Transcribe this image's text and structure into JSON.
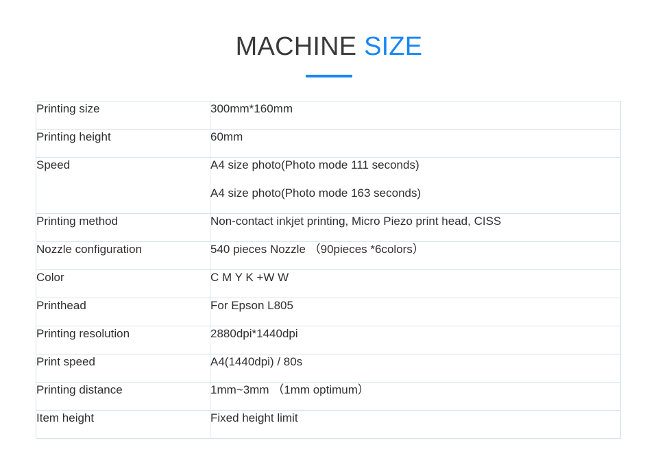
{
  "header": {
    "title_main": "MACHINE ",
    "title_accent": "SIZE",
    "accent_color": "#1687f5",
    "title_color": "#3a3a3a",
    "underline_color": "#1687f5"
  },
  "spec_table": {
    "border_color": "#d4e4f2",
    "rows": [
      {
        "label": "Printing size",
        "values": [
          "300mm*160mm"
        ]
      },
      {
        "label": "Printing height",
        "values": [
          "60mm"
        ]
      },
      {
        "label": "Speed",
        "values": [
          "A4 size photo(Photo mode 111 seconds)",
          "A4 size photo(Photo mode 163 seconds)"
        ]
      },
      {
        "label": "Printing method",
        "values": [
          "Non-contact inkjet printing, Micro Piezo print head, CISS"
        ]
      },
      {
        "label": "Nozzle configuration",
        "values": [
          "540 pieces Nozzle （90pieces *6colors）"
        ]
      },
      {
        "label": "Color",
        "values": [
          "C M Y K +W W"
        ]
      },
      {
        "label": "Printhead",
        "values": [
          "For Epson L805"
        ]
      },
      {
        "label": "Printing resolution",
        "values": [
          "2880dpi*1440dpi"
        ]
      },
      {
        "label": "Print speed",
        "values": [
          "A4(1440dpi) / 80s"
        ]
      },
      {
        "label": "Printing distance",
        "values": [
          "1mm~3mm （1mm optimum）"
        ]
      },
      {
        "label": "Item height",
        "values": [
          "Fixed height limit"
        ]
      }
    ]
  }
}
